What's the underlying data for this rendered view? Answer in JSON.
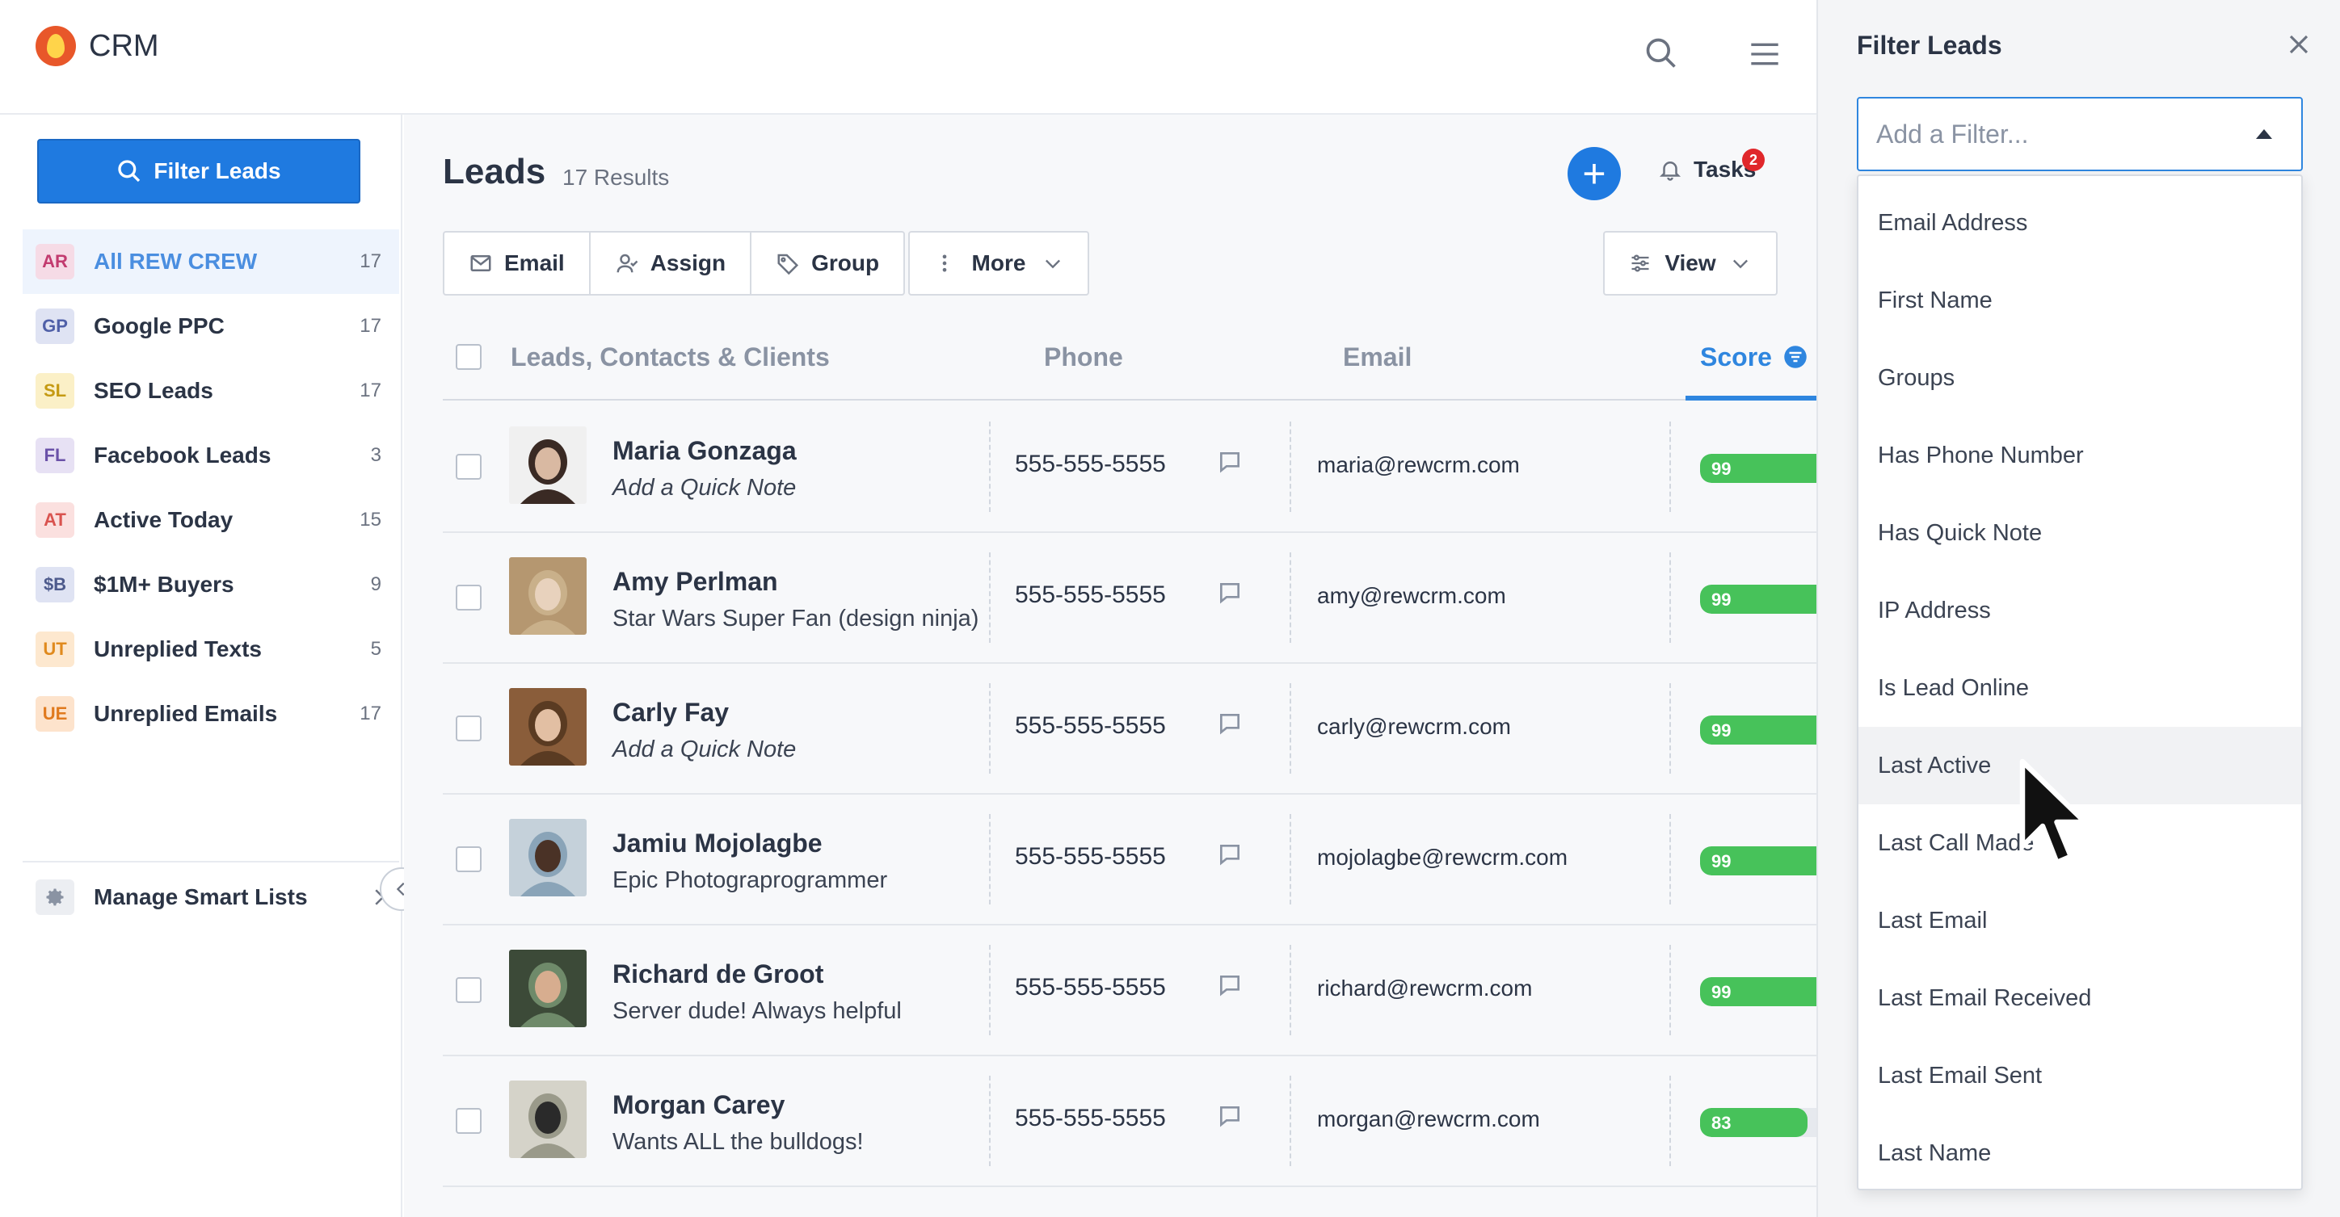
{
  "app": {
    "title": "CRM"
  },
  "colors": {
    "accent": "#1f7ae0",
    "score_green": "#47c25a",
    "badge_red": "#e0272b"
  },
  "sidebar": {
    "filter_button": "Filter Leads",
    "items": [
      {
        "badge": "AR",
        "label": "All REW CREW",
        "count": "17",
        "badge_bg": "#f6dbe6",
        "badge_fg": "#c23b6f",
        "active": true
      },
      {
        "badge": "GP",
        "label": "Google PPC",
        "count": "17",
        "badge_bg": "#dfe3f3",
        "badge_fg": "#5060a8"
      },
      {
        "badge": "SL",
        "label": "SEO Leads",
        "count": "17",
        "badge_bg": "#fbf0c7",
        "badge_fg": "#c59a13"
      },
      {
        "badge": "FL",
        "label": "Facebook Leads",
        "count": "3",
        "badge_bg": "#e7e1f4",
        "badge_fg": "#6a51a8"
      },
      {
        "badge": "AT",
        "label": "Active Today",
        "count": "15",
        "badge_bg": "#fbe0df",
        "badge_fg": "#d9534f"
      },
      {
        "badge": "$B",
        "label": "$1M+ Buyers",
        "count": "9",
        "badge_bg": "#dfe3f3",
        "badge_fg": "#4d5a8c"
      },
      {
        "badge": "UT",
        "label": "Unreplied Texts",
        "count": "5",
        "badge_bg": "#fde8cf",
        "badge_fg": "#e08a1e"
      },
      {
        "badge": "UE",
        "label": "Unreplied Emails",
        "count": "17",
        "badge_bg": "#fde3cc",
        "badge_fg": "#e07a1e"
      }
    ],
    "manage_label": "Manage Smart Lists"
  },
  "main": {
    "title": "Leads",
    "results": "17 Results",
    "tasks_label": "Tasks",
    "tasks_count": "2",
    "toolbar": {
      "email": "Email",
      "assign": "Assign",
      "group": "Group",
      "more": "More",
      "view": "View"
    },
    "columns": {
      "name": "Leads, Contacts & Clients",
      "phone": "Phone",
      "email": "Email",
      "score": "Score"
    },
    "rows": [
      {
        "name": "Maria Gonzaga",
        "note": "Add a Quick Note",
        "note_empty": true,
        "phone": "555-555-5555",
        "email": "maria@rewcrm.com",
        "score": "99",
        "score_pct": 99,
        "avatar": [
          "#3a2a24",
          "#d9b9a2",
          "#f0f0f0"
        ]
      },
      {
        "name": "Amy Perlman",
        "note": "Star Wars Super Fan (design ninja)",
        "note_empty": false,
        "phone": "555-555-5555",
        "email": "amy@rewcrm.com",
        "score": "99",
        "score_pct": 99,
        "avatar": [
          "#c9b08a",
          "#e8d2bd",
          "#b59770"
        ]
      },
      {
        "name": "Carly Fay",
        "note": "Add a Quick Note",
        "note_empty": true,
        "phone": "555-555-5555",
        "email": "carly@rewcrm.com",
        "score": "99",
        "score_pct": 99,
        "avatar": [
          "#5a3b22",
          "#e2bfa3",
          "#8a5d3a"
        ]
      },
      {
        "name": "Jamiu Mojolagbe",
        "note": "Epic Photograprogrammer",
        "note_empty": false,
        "phone": "555-555-5555",
        "email": "mojolagbe@rewcrm.com",
        "score": "99",
        "score_pct": 99,
        "avatar": [
          "#8aa4b8",
          "#4a3226",
          "#c5d1da"
        ]
      },
      {
        "name": "Richard de Groot",
        "note": "Server dude! Always helpful",
        "note_empty": false,
        "phone": "555-555-5555",
        "email": "richard@rewcrm.com",
        "score": "99",
        "score_pct": 99,
        "avatar": [
          "#6f8a6a",
          "#d7ad8f",
          "#3c4a38"
        ]
      },
      {
        "name": "Morgan Carey",
        "note": "Wants ALL the bulldogs!",
        "note_empty": false,
        "phone": "555-555-5555",
        "email": "morgan@rewcrm.com",
        "score": "83",
        "score_pct": 83,
        "avatar": [
          "#9a9a8a",
          "#2a2a2a",
          "#d5d3c9"
        ]
      }
    ]
  },
  "panel": {
    "title": "Filter Leads",
    "placeholder": "Add a Filter...",
    "options": [
      "Email Address",
      "First Name",
      "Groups",
      "Has Phone Number",
      "Has Quick Note",
      "IP Address",
      "Is Lead Online",
      "Last Active",
      "Last Call Made",
      "Last Email",
      "Last Email Received",
      "Last Email Sent",
      "Last Name"
    ],
    "hovered_option": "Last Active"
  }
}
